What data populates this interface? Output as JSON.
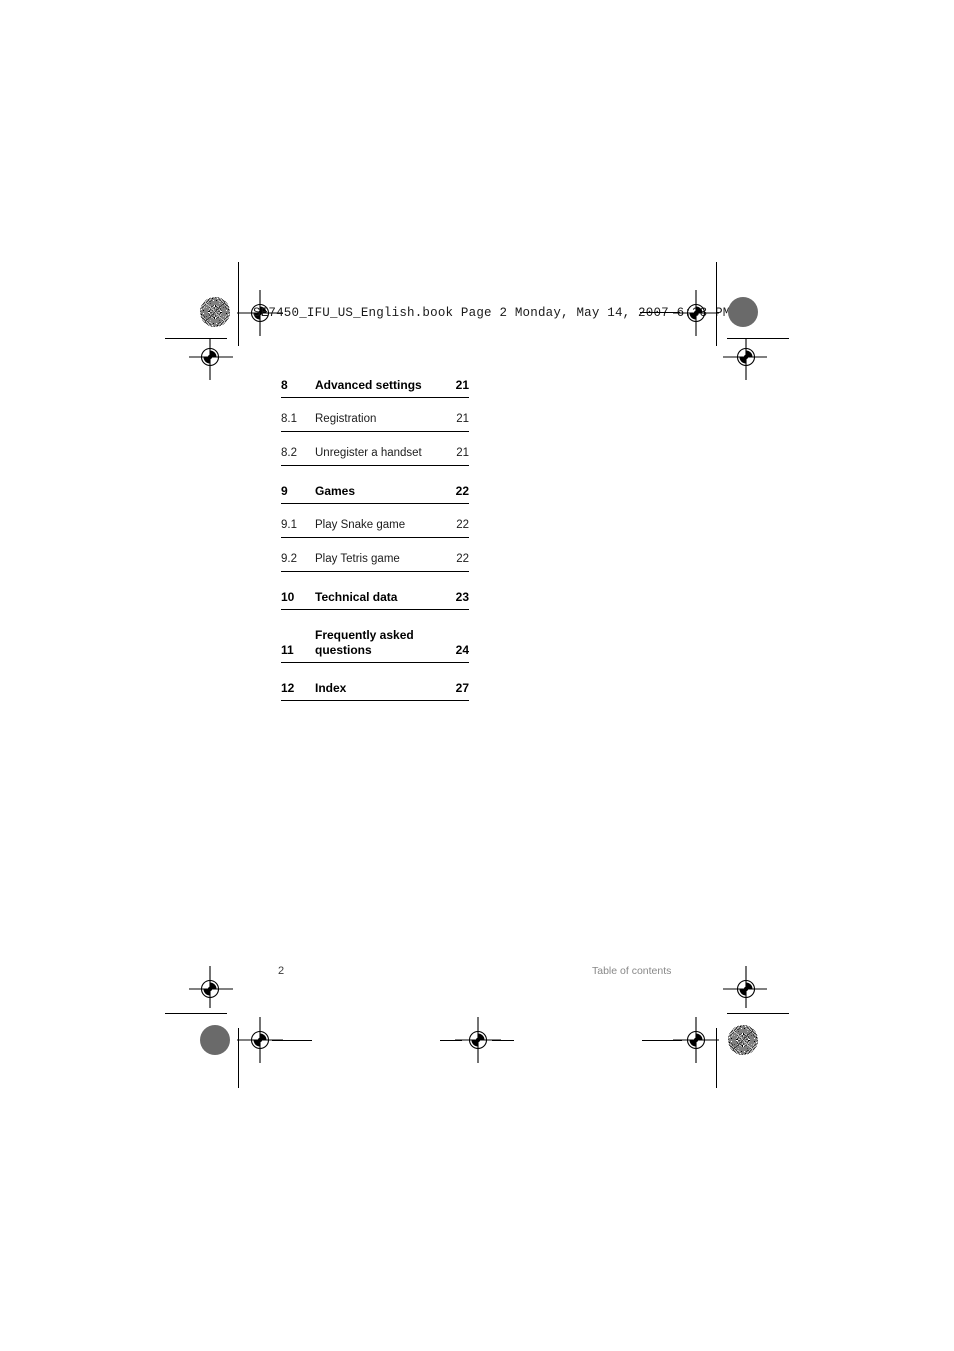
{
  "document": {
    "book_header": "SE7450_IFU_US_English.book  Page 2  Monday, May 14, 2007  6:33 PM"
  },
  "toc": {
    "entries": [
      {
        "number": "8",
        "title": "Advanced settings",
        "page": "21",
        "level": 1
      },
      {
        "number": "8.1",
        "title": "Registration",
        "page": "21",
        "level": 2
      },
      {
        "number": "8.2",
        "title": "Unregister a handset",
        "page": "21",
        "level": 2
      },
      {
        "number": "9",
        "title": "Games",
        "page": "22",
        "level": 1
      },
      {
        "number": "9.1",
        "title": "Play Snake game",
        "page": "22",
        "level": 2
      },
      {
        "number": "9.2",
        "title": "Play Tetris game",
        "page": "22",
        "level": 2
      },
      {
        "number": "10",
        "title": "Technical data",
        "page": "23",
        "level": 1
      },
      {
        "number": "11",
        "title": "Frequently asked\nquestions",
        "page": "24",
        "level": 1
      },
      {
        "number": "12",
        "title": "Index",
        "page": "27",
        "level": 1
      }
    ]
  },
  "footer": {
    "page_number": "2",
    "section_name": "Table of contents"
  },
  "colors": {
    "text": "#000000",
    "footer_muted": "#888888",
    "rule": "#000000",
    "registration_mark": "#000000",
    "solid_dot": "#6a6a6a",
    "page_background": "#ffffff"
  },
  "print_marks": {
    "registration_mark_label": "registration-target",
    "solid_dot_label": "solid-density-patch",
    "star_dot_label": "star-density-patch",
    "trim_line_label": "trim-line"
  }
}
